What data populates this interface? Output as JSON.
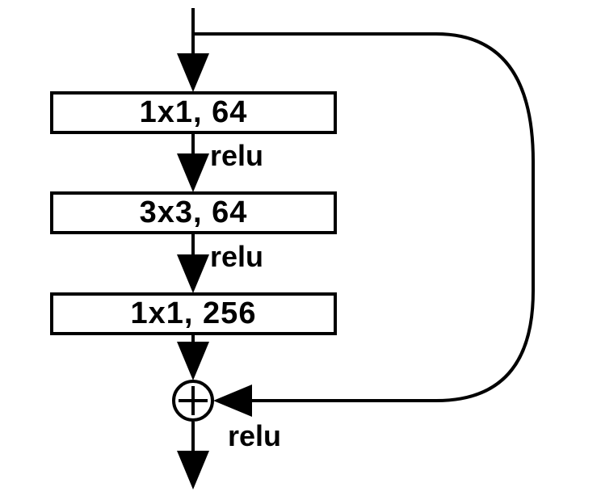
{
  "diagram": {
    "type": "residual_block",
    "description": "ResNet bottleneck residual block",
    "blocks": [
      {
        "label": "1x1, 64",
        "kernel": "1x1",
        "channels": 64
      },
      {
        "label": "3x3, 64",
        "kernel": "3x3",
        "channels": 64
      },
      {
        "label": "1x1, 256",
        "kernel": "1x1",
        "channels": 256
      }
    ],
    "activations": {
      "relu1": "relu",
      "relu2": "relu",
      "relu3": "relu"
    },
    "merge_op": "add",
    "skip_connection": true
  }
}
